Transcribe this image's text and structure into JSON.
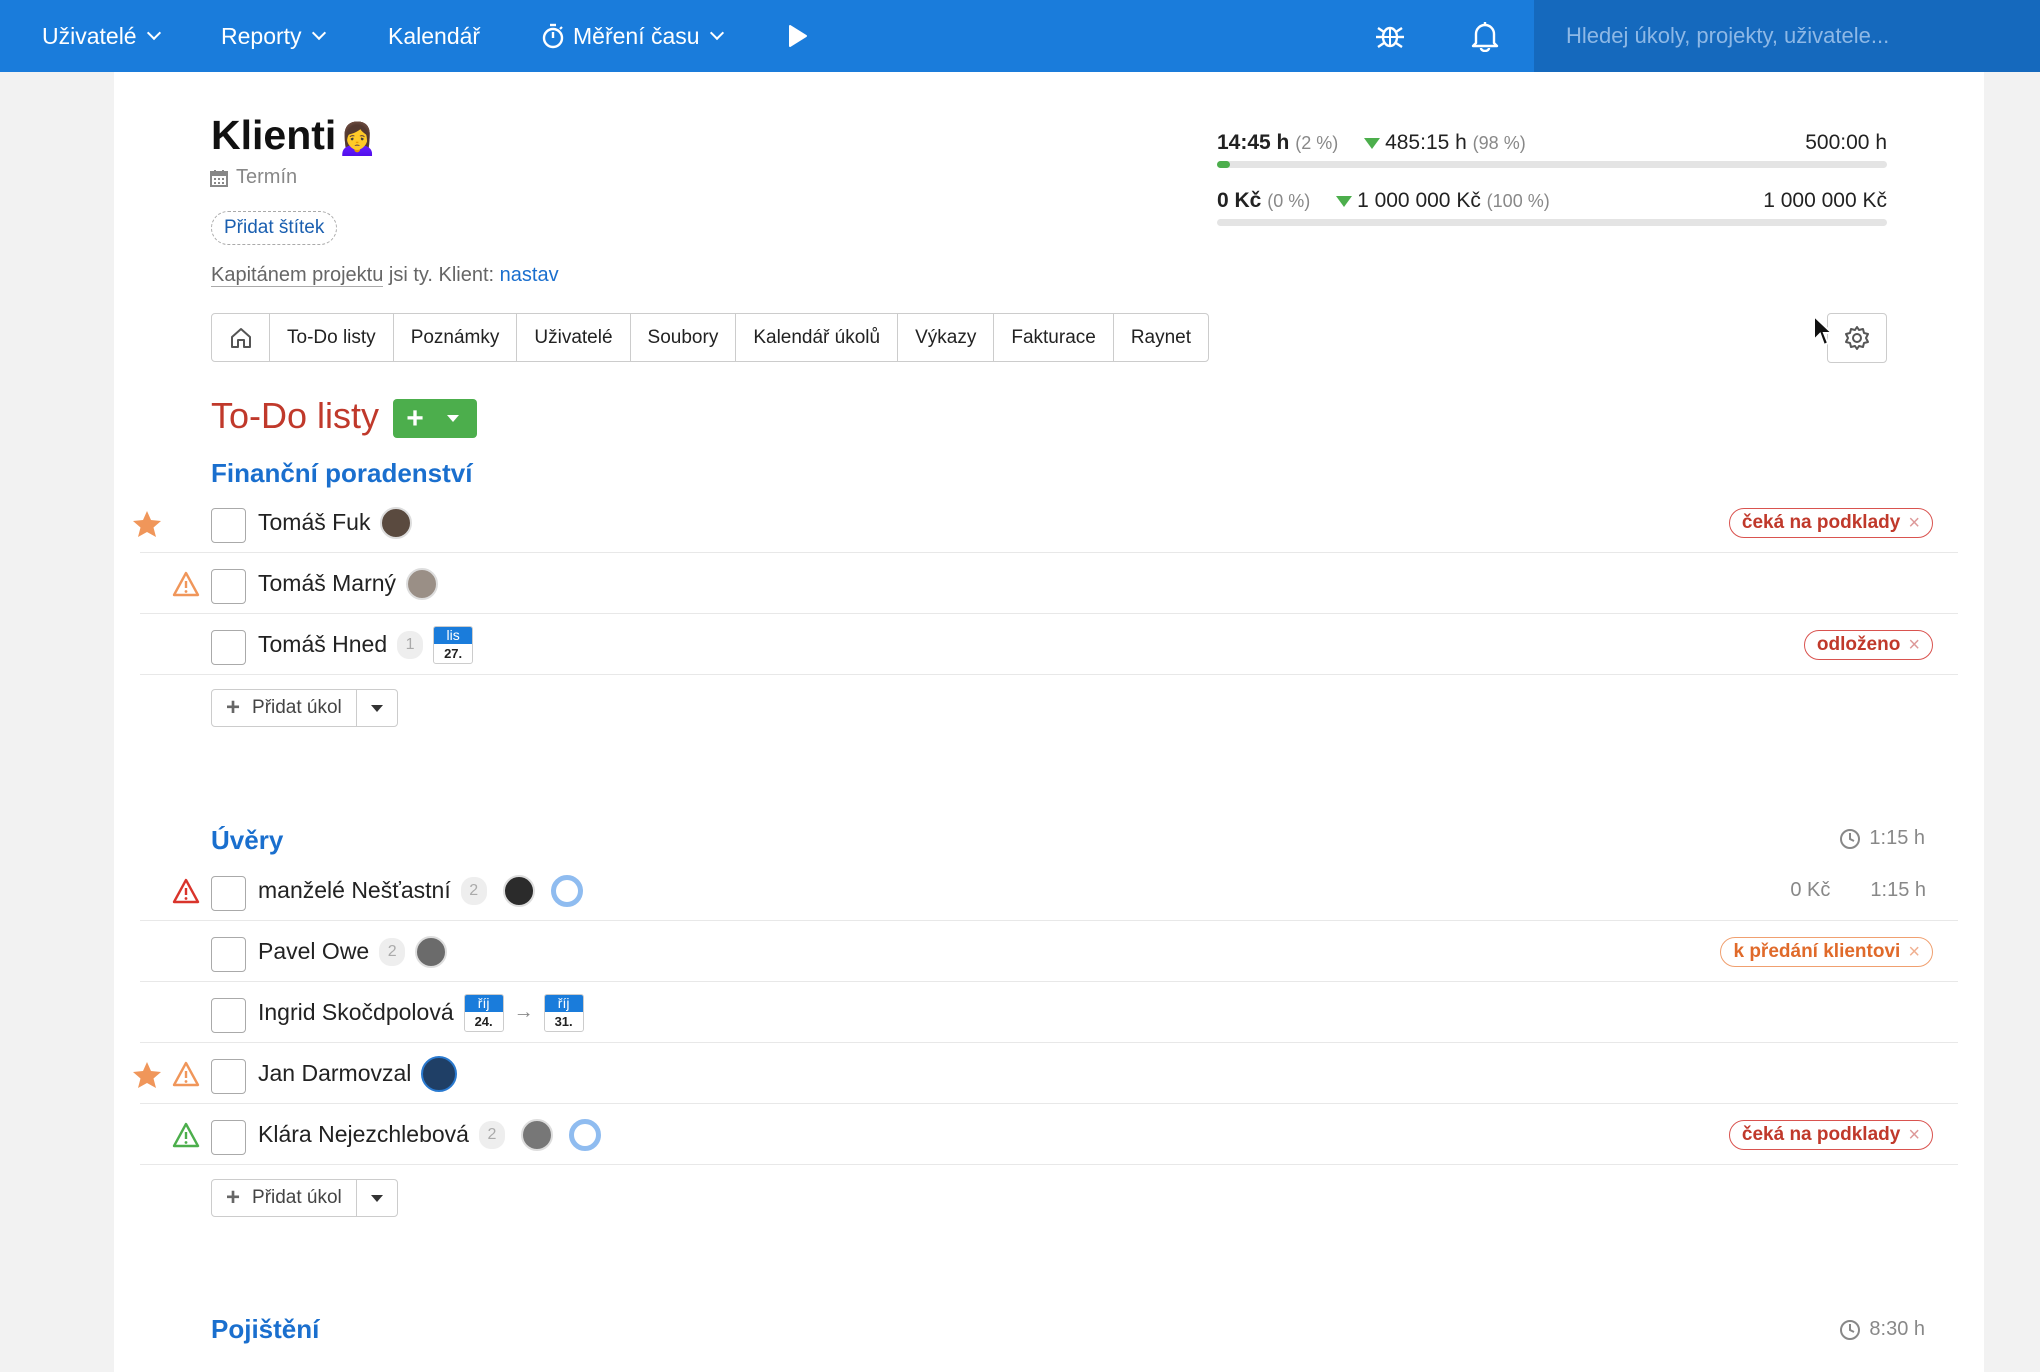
{
  "nav": {
    "users": "Uživatelé",
    "reports": "Reporty",
    "calendar": "Kalendář",
    "time": "Měření času",
    "search_placeholder": "Hledej úkoly, projekty, uživatele..."
  },
  "project": {
    "title": "Klienti",
    "emoji": "🙍‍♀️",
    "deadline": "Termín",
    "add_tag": "Přidat štítek",
    "captain_prefix": "Kapitánem projektu",
    "captain_mid": " jsi ty. Klient: ",
    "captain_link": "nastav"
  },
  "stats": {
    "time": {
      "spent": "14:45 h",
      "spent_pct": "(2 %)",
      "remaining": "485:15 h",
      "remaining_pct": "(98 %)",
      "total": "500:00 h",
      "progress": 0.02
    },
    "money": {
      "spent": "0 Kč",
      "spent_pct": "(0 %)",
      "remaining": "1 000 000 Kč",
      "remaining_pct": "(100 %)",
      "total": "1 000 000 Kč",
      "progress": 0
    }
  },
  "tabs": [
    "To-Do listy",
    "Poznámky",
    "Uživatelé",
    "Soubory",
    "Kalendář úkolů",
    "Výkazy",
    "Fakturace",
    "Raynet"
  ],
  "section_title": "To-Do listy",
  "add_task_label": "Přidat úkol",
  "lists": [
    {
      "title": "Finanční poradenství",
      "tasks": [
        {
          "name": "Tomáš Fuk",
          "badge": "čeká na podklady"
        },
        {
          "name": "Tomáš Marný"
        },
        {
          "name": "Tomáš Hned",
          "count": "1",
          "date_month": "lis",
          "date_day": "27.",
          "badge": "odloženo"
        }
      ]
    },
    {
      "title": "Úvěry",
      "time": "1:15 h",
      "tasks": [
        {
          "name": "manželé Nešťastní",
          "count": "2",
          "money": "0 Kč",
          "time": "1:15 h"
        },
        {
          "name": "Pavel Owe",
          "count": "2",
          "badge": "k předání klientovi"
        },
        {
          "name": "Ingrid Skočdpolová",
          "date_month": "říj",
          "date_day": "24.",
          "date2_month": "říj",
          "date2_day": "31."
        },
        {
          "name": "Jan Darmovzal"
        },
        {
          "name": "Klára Nejezchlebová",
          "count": "2",
          "badge": "čeká na podklady"
        }
      ]
    },
    {
      "title": "Pojištění",
      "time": "8:30 h"
    }
  ]
}
